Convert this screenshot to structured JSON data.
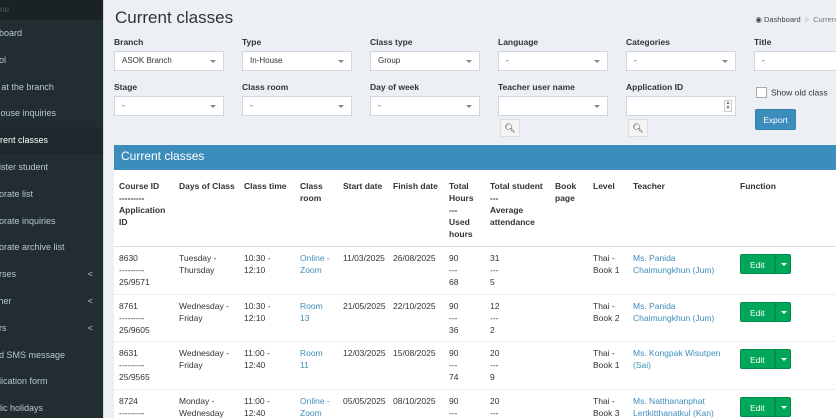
{
  "sidebar": {
    "menu_heading": "nu",
    "items": [
      {
        "label": "hboard",
        "arrow": ""
      },
      {
        "label": "ool",
        "arrow": ""
      },
      {
        "label": "ff at the branch",
        "arrow": ""
      },
      {
        "label": "House inquiries",
        "arrow": ""
      },
      {
        "label": "rrent classes",
        "arrow": "",
        "active": true
      },
      {
        "label": "gister student",
        "arrow": ""
      },
      {
        "label": "porate list",
        "arrow": ""
      },
      {
        "label": "porate inquiries",
        "arrow": ""
      },
      {
        "label": "porate archive list",
        "arrow": ""
      },
      {
        "label": "urses",
        "arrow": "<"
      },
      {
        "label": "cher",
        "arrow": "<"
      },
      {
        "label": "ers",
        "arrow": "<"
      },
      {
        "label": "nd SMS message",
        "arrow": ""
      },
      {
        "label": "plication form",
        "arrow": ""
      },
      {
        "label": "blic holidays",
        "arrow": ""
      }
    ]
  },
  "header": {
    "title": "Current classes",
    "breadcrumb_home": "Dashboard",
    "breadcrumb_current": "Curren",
    "home_icon": "dashboard-icon"
  },
  "filters": {
    "branch": {
      "label": "Branch",
      "value": "ASOK Branch"
    },
    "type": {
      "label": "Type",
      "value": "In-House"
    },
    "class_type": {
      "label": "Class type",
      "value": "Group"
    },
    "language": {
      "label": "Language",
      "value": "-"
    },
    "categories": {
      "label": "Categories",
      "value": "-"
    },
    "title": {
      "label": "Title",
      "value": "-"
    },
    "stage": {
      "label": "Stage",
      "value": "-"
    },
    "class_room": {
      "label": "Class room",
      "value": "-"
    },
    "day_of_week": {
      "label": "Day of week",
      "value": "-"
    },
    "teacher_user_name": {
      "label": "Teacher user name",
      "value": ""
    },
    "application_id": {
      "label": "Application ID",
      "value": ""
    },
    "show_old_class": {
      "label": "Show old class",
      "checked": false
    },
    "export_label": "Export",
    "search_icon": "search-icon"
  },
  "table": {
    "heading": "Current classes",
    "columns": [
      "Course ID\n---------\nApplication ID",
      "Days of Class",
      "Class time",
      "Class room",
      "Start date",
      "Finish date",
      "Total Hours\n---\nUsed hours",
      "Total student\n---\nAverage attendance",
      "Book page",
      "Level",
      "Teacher",
      "Function"
    ],
    "rows": [
      {
        "course": "8630\n---------\n25/9571",
        "days": "Tuesday -\nThursday",
        "time": "10:30 -\n12:10",
        "room": "Online -\nZoom",
        "start": "11/03/2025",
        "finish": "26/08/2025",
        "hours": "90\n---\n68",
        "students": "31\n---\n5",
        "book": "",
        "level": "Thai -\nBook 1",
        "teacher": "Ms. Panida\nChaimungkhun (Jum)",
        "edit": "Edit"
      },
      {
        "course": "8761\n---------\n25/9605",
        "days": "Wednesday -\nFriday",
        "time": "10:30 -\n12:10",
        "room": "Room\n13",
        "start": "21/05/2025",
        "finish": "22/10/2025",
        "hours": "90\n---\n36",
        "students": "12\n---\n2",
        "book": "",
        "level": "Thai -\nBook 2",
        "teacher": "Ms. Panida\nChaimungkhun (Jum)",
        "edit": "Edit"
      },
      {
        "course": "8631\n---------\n25/9565",
        "days": "Wednesday -\nFriday",
        "time": "11:00 -\n12:40",
        "room": "Room\n11",
        "start": "12/03/2025",
        "finish": "15/08/2025",
        "hours": "90\n---\n74",
        "students": "20\n---\n9",
        "book": "",
        "level": "Thai -\nBook 1",
        "teacher": "Ms. Kongpak Wisutpen\n(Sai)",
        "edit": "Edit"
      },
      {
        "course": "8724\n---------\n",
        "days": "Monday -\nWednesday",
        "time": "11:00 -\n12:40",
        "room": "Online -\nZoom",
        "start": "05/05/2025",
        "finish": "08/10/2025",
        "hours": "90\n---\n",
        "students": "20\n---\n",
        "book": "",
        "level": "Thai -\nBook 3",
        "teacher": "Ms. Natthananphat\nLertkitthanatkul (Kan)",
        "edit": "Edit"
      }
    ]
  }
}
